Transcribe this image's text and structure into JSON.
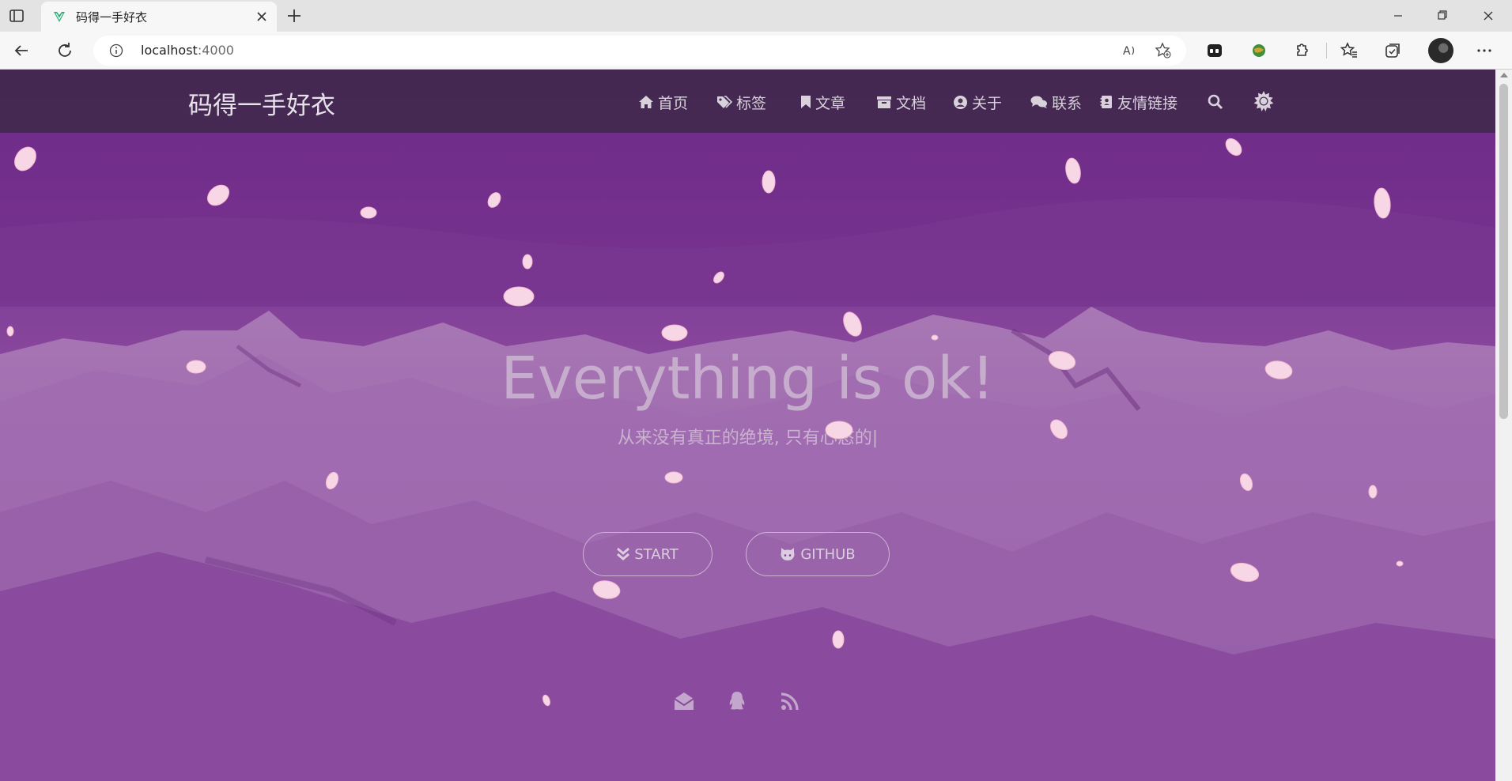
{
  "browser": {
    "tab_title": "码得一手好衣",
    "url_host": "localhost",
    "url_port": ":4000"
  },
  "site": {
    "brand": "码得一手好衣",
    "nav": [
      {
        "label": "首页",
        "icon": "home-icon"
      },
      {
        "label": "标签",
        "icon": "tags-icon"
      },
      {
        "label": "文章",
        "icon": "bookmark-icon"
      },
      {
        "label": "文档",
        "icon": "archive-icon"
      },
      {
        "label": "关于",
        "icon": "user-circle-icon"
      },
      {
        "label": "联系",
        "icon": "comments-icon"
      },
      {
        "label": "友情链接",
        "icon": "address-book-icon"
      }
    ]
  },
  "hero": {
    "title": "Everything is ok!",
    "subtitle": "从来没有真正的绝境, 只有心态的",
    "caret": "|",
    "buttons": [
      {
        "label": "START",
        "icon": "double-chevron-down-icon"
      },
      {
        "label": "GITHUB",
        "icon": "github-icon"
      }
    ],
    "social_icons": [
      "envelope-open-icon",
      "qq-penguin-icon",
      "rss-icon"
    ]
  },
  "colors": {
    "accent": "#7e3b95",
    "navbar": "#3c2846"
  }
}
